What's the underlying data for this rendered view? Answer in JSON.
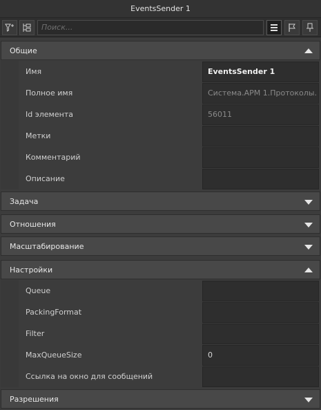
{
  "window": {
    "title": "EventsSender 1"
  },
  "toolbar": {
    "search_placeholder": "Поиск...",
    "filter_icon": "filter-icon",
    "tree_icon": "tree-filter-icon",
    "list_icon": "list-view-icon",
    "flag_icon": "flag-icon",
    "pin_icon": "pin-icon"
  },
  "sections": {
    "general": {
      "title": "Общие",
      "expanded": true,
      "rows": [
        {
          "label": "Имя",
          "value": "EventsSender 1"
        },
        {
          "label": "Полное имя",
          "value": "Система.АРМ 1.Протоколы."
        },
        {
          "label": "Id элемента",
          "value": "56011"
        },
        {
          "label": "Метки",
          "value": ""
        },
        {
          "label": "Комментарий",
          "value": ""
        },
        {
          "label": "Описание",
          "value": ""
        }
      ]
    },
    "task": {
      "title": "Задача",
      "expanded": false
    },
    "relations": {
      "title": "Отношения",
      "expanded": false
    },
    "scaling": {
      "title": "Масштабирование",
      "expanded": false
    },
    "settings": {
      "title": "Настройки",
      "expanded": true,
      "rows": [
        {
          "label": "Queue",
          "value": ""
        },
        {
          "label": "PackingFormat",
          "value": ""
        },
        {
          "label": "Filter",
          "value": ""
        },
        {
          "label": "MaxQueueSize",
          "value": "0"
        },
        {
          "label": "Ссылка на окно для сообщений",
          "value": ""
        }
      ]
    },
    "permissions": {
      "title": "Разрешения",
      "expanded": false
    }
  }
}
